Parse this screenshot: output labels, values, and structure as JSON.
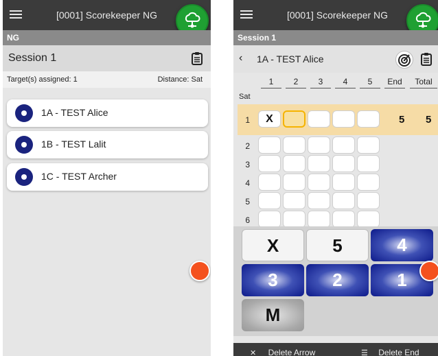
{
  "app": {
    "title": "[0001] Scorekeeper NG"
  },
  "left": {
    "subbar": "NG",
    "session_title": "Session 1",
    "targets_assigned": "Target(s) assigned: 1",
    "distance": "Distance: Sat",
    "archers": [
      {
        "label": "1A - TEST Alice"
      },
      {
        "label": "1B - TEST Lalit"
      },
      {
        "label": "1C - TEST Archer"
      }
    ]
  },
  "right": {
    "subbar": "Session 1",
    "back_icon": "‹",
    "archer": "1A - TEST Alice",
    "columns": [
      "1",
      "2",
      "3",
      "4",
      "5",
      "End",
      "Total"
    ],
    "distance_label": "Sat",
    "rows": [
      {
        "num": "1",
        "arrows": [
          "X",
          "",
          "",
          "",
          ""
        ],
        "end": "5",
        "total": "5"
      },
      {
        "num": "2",
        "arrows": [
          "",
          "",
          "",
          "",
          ""
        ],
        "end": "",
        "total": ""
      },
      {
        "num": "3",
        "arrows": [
          "",
          "",
          "",
          "",
          ""
        ],
        "end": "",
        "total": ""
      },
      {
        "num": "4",
        "arrows": [
          "",
          "",
          "",
          "",
          ""
        ],
        "end": "",
        "total": ""
      },
      {
        "num": "5",
        "arrows": [
          "",
          "",
          "",
          "",
          ""
        ],
        "end": "",
        "total": ""
      },
      {
        "num": "6",
        "arrows": [
          "",
          "",
          "",
          "",
          ""
        ],
        "end": "",
        "total": ""
      }
    ],
    "keypad": [
      "X",
      "5",
      "4",
      "3",
      "2",
      "1",
      "M"
    ],
    "delete_arrow": "Delete Arrow",
    "delete_end": "Delete End"
  },
  "icons": {
    "menu": "hamburger-menu-icon",
    "cloud": "cloud-sync-icon",
    "clipboard": "clipboard-icon",
    "target": "target-icon"
  },
  "colors": {
    "topbar": "#3b3b3b",
    "fab_green": "#1fa032",
    "target_blue": "#1a237e",
    "highlight_row": "#f6dca6",
    "active_cell_border": "#f5b301",
    "key_blue": "#0d1a8a",
    "fab_orange": "#f4511e"
  }
}
